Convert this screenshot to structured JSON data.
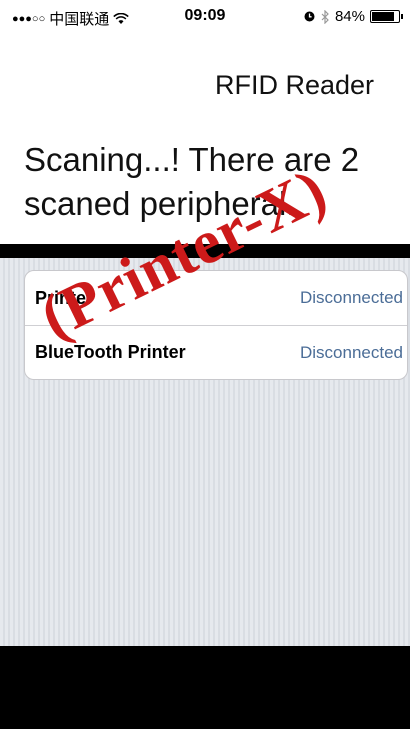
{
  "status_bar": {
    "signal_dots": "●●●○○",
    "carrier": "中国联通",
    "time": "09:09",
    "battery_percent": "84%",
    "battery_level": 0.84
  },
  "nav": {
    "title": "RFID Reader"
  },
  "scan_message": "Scaning...! There are 2 scaned peripheral.",
  "devices": [
    {
      "name": "Printer",
      "status": "Disconnected"
    },
    {
      "name": "BlueTooth Printer",
      "status": "Disconnected"
    }
  ],
  "watermark": "(Printer-X)",
  "colors": {
    "status_text": "#4b6d97",
    "watermark": "#cc1a1a",
    "table_background": "#e2e5ea"
  },
  "icons": [
    "wifi-icon",
    "alarm-icon",
    "bluetooth-icon",
    "battery-icon"
  ]
}
